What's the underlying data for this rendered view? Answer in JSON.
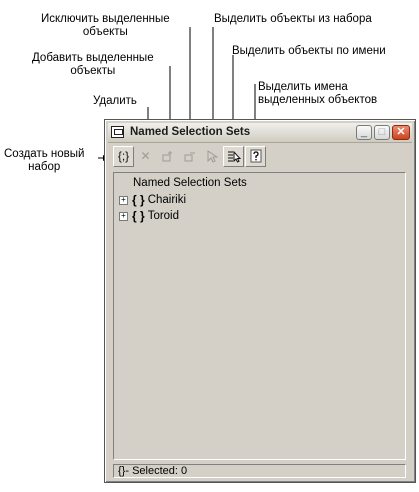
{
  "callouts": {
    "exclude": "Исключить выделенные\nобъекты",
    "add": "Добавить выделенные\nобъекты",
    "delete": "Удалить",
    "create": "Создать новый\nнабор",
    "select_objects": "Выделить объекты из набора",
    "select_by_name": "Выделить объекты по имени",
    "select_names": "Выделить имена\nвыделенных объектов"
  },
  "window": {
    "title": "Named Selection Sets",
    "min_glyph": "_",
    "max_glyph": "□",
    "close_glyph": "✕"
  },
  "toolbar": {
    "create_glyph": "{;}",
    "delete_glyph": "✕"
  },
  "tree": {
    "root": "Named Selection Sets",
    "expand_glyph": "+",
    "set_glyph": "{ }",
    "items": [
      {
        "label": "Chairiki"
      },
      {
        "label": "Toroid"
      }
    ]
  },
  "status": {
    "text": "{}- Selected: 0"
  },
  "icons": {
    "app": "window-icon",
    "select_objects": "select-objects-icon",
    "select_by_name": "select-by-name-icon",
    "help": "help-icon"
  }
}
